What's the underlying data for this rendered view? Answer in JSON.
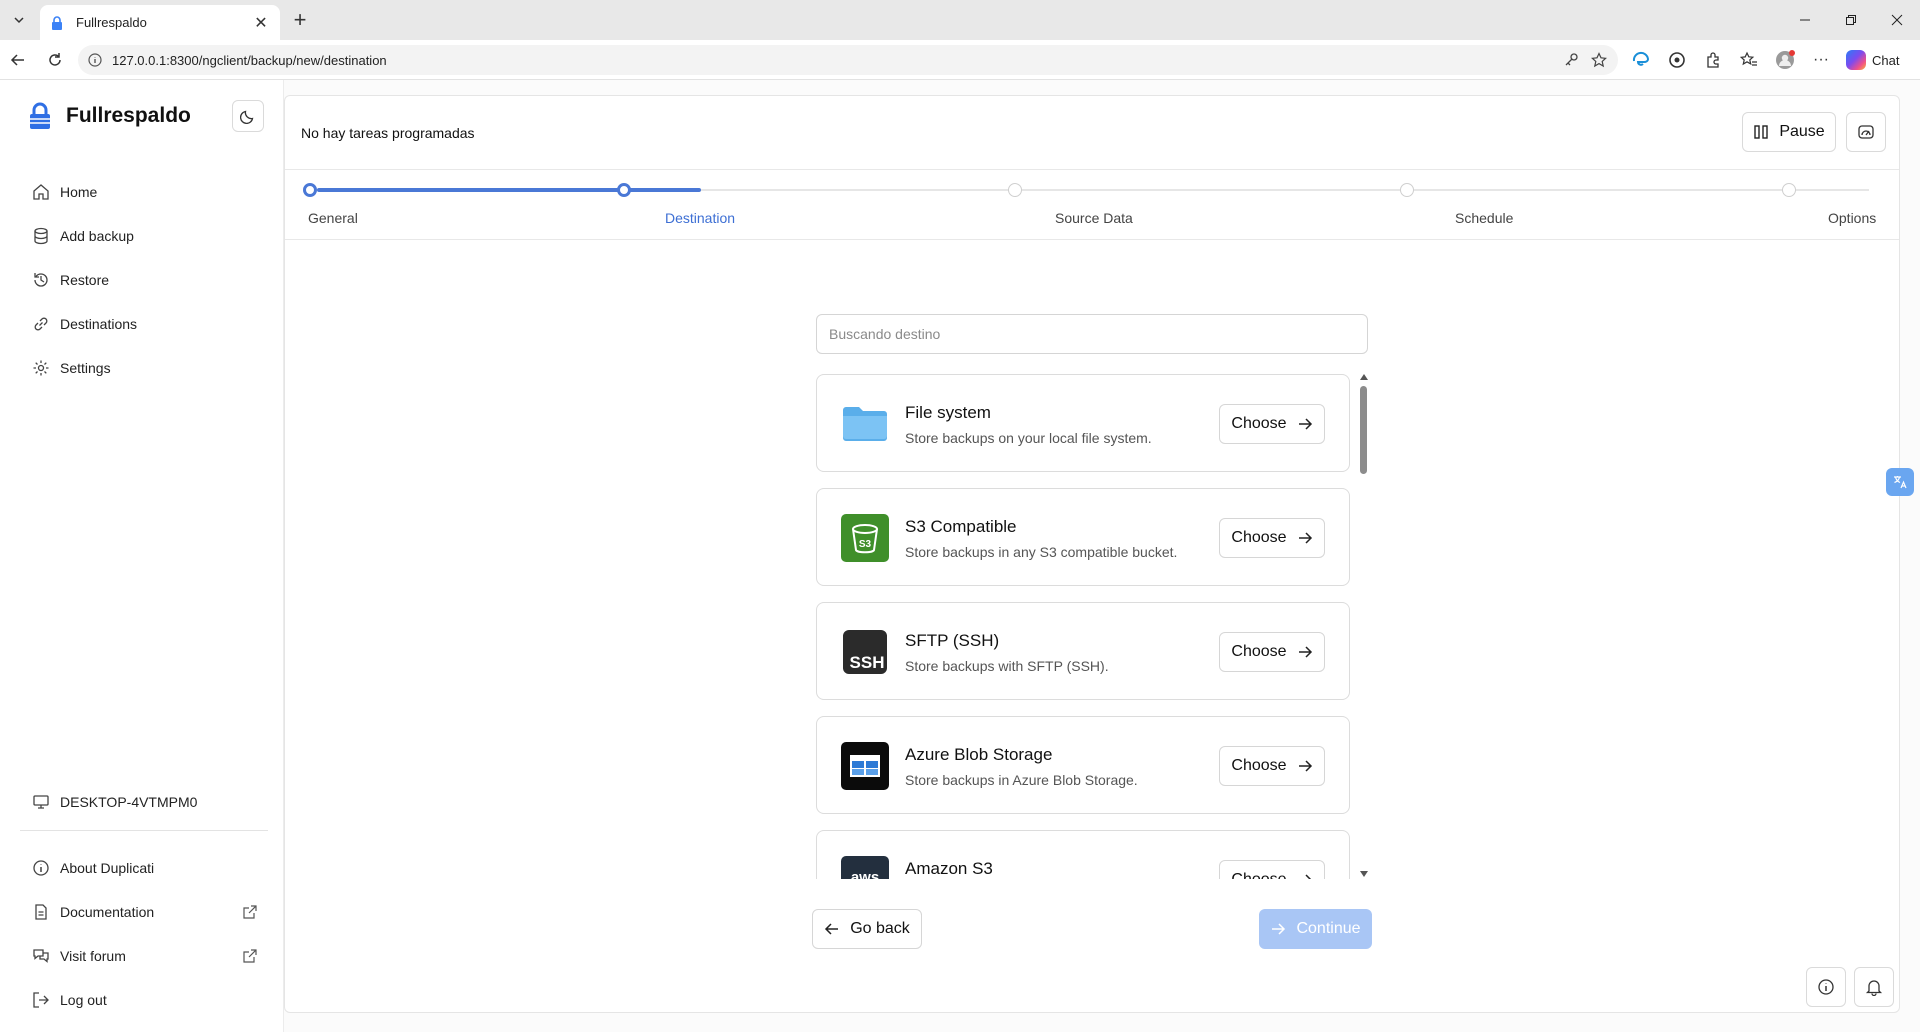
{
  "browser": {
    "tab_title": "Fullrespaldo",
    "url": "127.0.0.1:8300/ngclient/backup/new/destination",
    "chat_label": "Chat"
  },
  "sidebar": {
    "brand": "Fullrespaldo",
    "nav": [
      {
        "label": "Home",
        "icon": "home-icon"
      },
      {
        "label": "Add backup",
        "icon": "database-icon"
      },
      {
        "label": "Restore",
        "icon": "history-icon"
      },
      {
        "label": "Destinations",
        "icon": "link-icon"
      },
      {
        "label": "Settings",
        "icon": "gear-icon"
      }
    ],
    "machine_name": "DESKTOP-4VTMPM0",
    "bottom": [
      {
        "label": "About Duplicati",
        "icon": "info-icon"
      },
      {
        "label": "Documentation",
        "icon": "document-icon"
      },
      {
        "label": "Visit forum",
        "icon": "chat-bubbles-icon"
      },
      {
        "label": "Log out",
        "icon": "logout-icon"
      }
    ]
  },
  "header": {
    "status": "No hay tareas programadas",
    "pause_label": "Pause"
  },
  "stepper": {
    "steps": [
      "General",
      "Destination",
      "Source Data",
      "Schedule",
      "Options"
    ],
    "current_index": 1
  },
  "search": {
    "placeholder": "Buscando destino"
  },
  "destinations": [
    {
      "name": "File system",
      "description": "Store backups on your local file system.",
      "icon": "folder-icon",
      "action": "Choose"
    },
    {
      "name": "S3 Compatible",
      "description": "Store backups in any S3 compatible bucket.",
      "icon": "s3-bucket-icon",
      "action": "Choose"
    },
    {
      "name": "SFTP (SSH)",
      "description": "Store backups with SFTP (SSH).",
      "icon": "ssh-icon",
      "action": "Choose"
    },
    {
      "name": "Azure Blob Storage",
      "description": "Store backups in Azure Blob Storage.",
      "icon": "azure-icon",
      "action": "Choose"
    },
    {
      "name": "Amazon S3",
      "description": "",
      "icon": "aws-icon",
      "action": "Choose"
    }
  ],
  "footer": {
    "back_label": "Go back",
    "continue_label": "Continue"
  },
  "colors": {
    "accent": "#4a78d6",
    "continue_disabled": "#a9c6f5"
  }
}
